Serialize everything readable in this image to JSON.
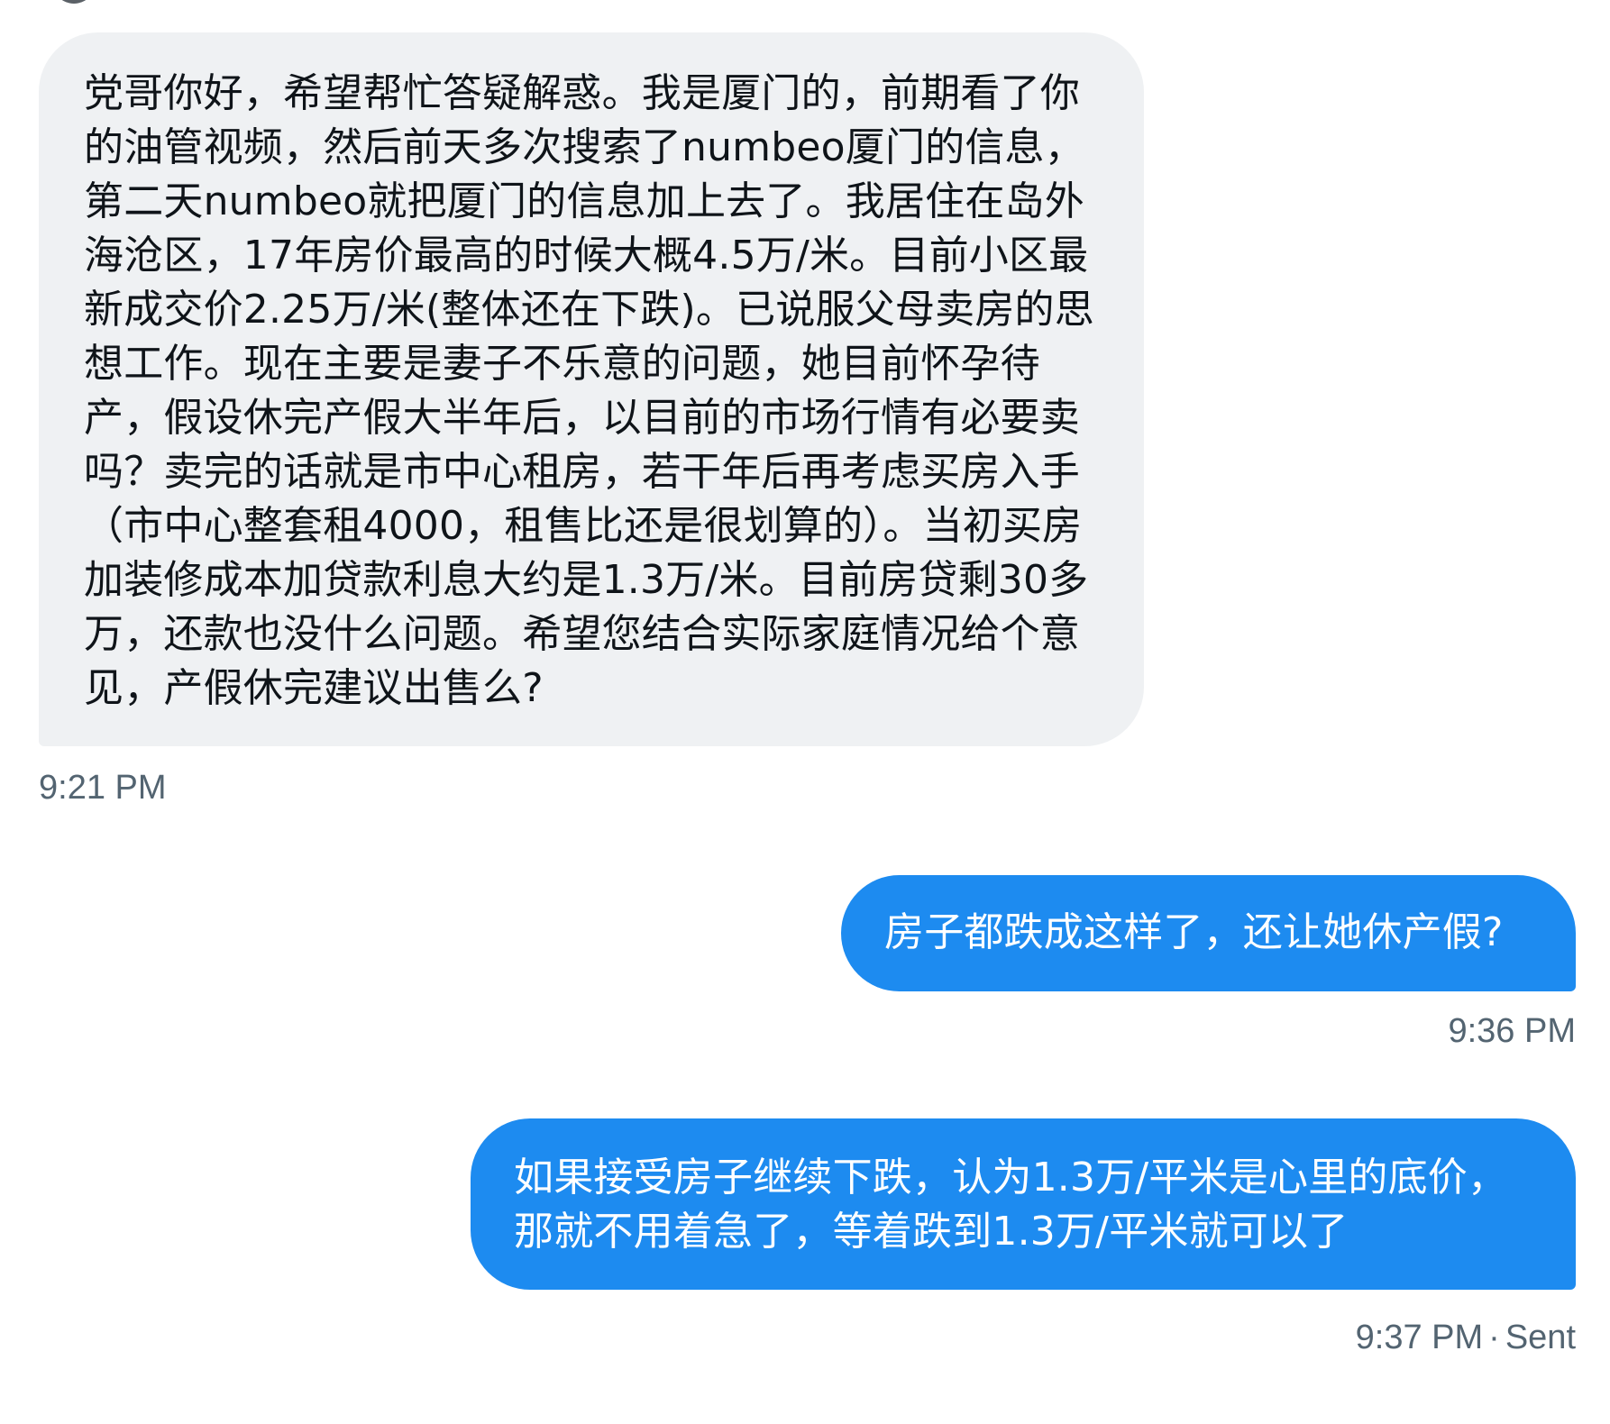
{
  "messages": [
    {
      "direction": "received",
      "text": "党哥你好，希望帮忙答疑解惑。我是厦门的，前期看了你的油管视频，然后前天多次搜索了numbeo厦门的信息，第二天numbeo就把厦门的信息加上去了。我居住在岛外海沧区，17年房价最高的时候大概4.5万/米。目前小区最新成交价2.25万/米(整体还在下跌)。已说服父母卖房的思想工作。现在主要是妻子不乐意的问题，她目前怀孕待产，假设休完产假大半年后，以目前的市场行情有必要卖吗？卖完的话就是市中心租房，若干年后再考虑买房入手（市中心整套租4000，租售比还是很划算的）。当初买房加装修成本加贷款利息大约是1.3万/米。目前房贷剩30多万，还款也没什么问题。希望您结合实际家庭情况给个意见，产假休完建议出售么?",
      "time": "9:21 PM"
    },
    {
      "direction": "sent",
      "text": "房子都跌成这样了，还让她休产假?",
      "time": "9:36 PM"
    },
    {
      "direction": "sent",
      "text": "如果接受房子继续下跌，认为1.3万/平米是心里的底价，那就不用着急了，等着跌到1.3万/平米就可以了",
      "time": "9:37 PM",
      "separator": "·",
      "status": "Sent"
    }
  ],
  "colors": {
    "received_bubble": "#eff1f3",
    "sent_bubble": "#1d8bf0",
    "timestamp": "#536471"
  }
}
